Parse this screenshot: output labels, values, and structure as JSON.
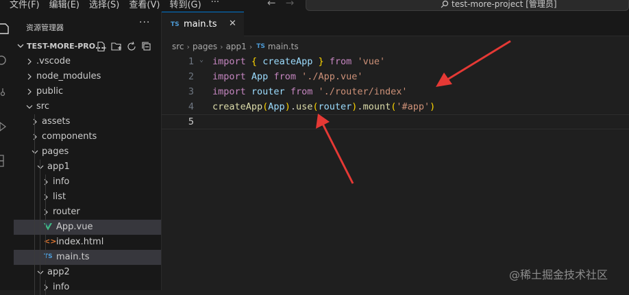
{
  "menu": [
    "文件(F)",
    "编辑(E)",
    "选择(S)",
    "查看(V)",
    "转到(G)",
    "···"
  ],
  "title_search": "test-more-project [管理员]",
  "sidebar": {
    "title": "资源管理器",
    "more": "···",
    "project": "TEST-MORE-PRO...",
    "tree": [
      {
        "label": ".vscode",
        "type": "folder",
        "level": 0,
        "expanded": false
      },
      {
        "label": "node_modules",
        "type": "folder",
        "level": 0,
        "expanded": false
      },
      {
        "label": "public",
        "type": "folder",
        "level": 0,
        "expanded": false
      },
      {
        "label": "src",
        "type": "folder",
        "level": 0,
        "expanded": true
      },
      {
        "label": "assets",
        "type": "folder",
        "level": 1,
        "expanded": false
      },
      {
        "label": "components",
        "type": "folder",
        "level": 1,
        "expanded": false
      },
      {
        "label": "pages",
        "type": "folder",
        "level": 1,
        "expanded": true
      },
      {
        "label": "app1",
        "type": "folder",
        "level": 2,
        "expanded": true
      },
      {
        "label": "info",
        "type": "folder",
        "level": 3,
        "expanded": false
      },
      {
        "label": "list",
        "type": "folder",
        "level": 3,
        "expanded": false
      },
      {
        "label": "router",
        "type": "folder",
        "level": 3,
        "expanded": false
      },
      {
        "label": "App.vue",
        "type": "vue",
        "level": 3,
        "active": true
      },
      {
        "label": "index.html",
        "type": "html",
        "level": 3
      },
      {
        "label": "main.ts",
        "type": "ts",
        "level": 3,
        "selected": true
      },
      {
        "label": "app2",
        "type": "folder",
        "level": 2,
        "expanded": true
      },
      {
        "label": "info",
        "type": "folder",
        "level": 3,
        "expanded": false
      }
    ]
  },
  "editor": {
    "tab": {
      "icon": "TS",
      "label": "main.ts",
      "close": "✕"
    },
    "breadcrumb": [
      "src",
      "pages",
      "app1"
    ],
    "breadcrumb_file": "main.ts",
    "lines": [
      {
        "n": "1",
        "tokens": [
          [
            "kw",
            "import"
          ],
          [
            "pn",
            " "
          ],
          [
            "br1",
            "{"
          ],
          [
            "pn",
            " "
          ],
          [
            "id",
            "createApp"
          ],
          [
            "pn",
            " "
          ],
          [
            "br1",
            "}"
          ],
          [
            "pn",
            " "
          ],
          [
            "kw",
            "from"
          ],
          [
            "pn",
            " "
          ],
          [
            "str",
            "'vue'"
          ]
        ]
      },
      {
        "n": "2",
        "tokens": [
          [
            "kw",
            "import"
          ],
          [
            "pn",
            " "
          ],
          [
            "id",
            "App"
          ],
          [
            "pn",
            " "
          ],
          [
            "kw",
            "from"
          ],
          [
            "pn",
            " "
          ],
          [
            "str",
            "'./App.vue'"
          ]
        ]
      },
      {
        "n": "3",
        "tokens": [
          [
            "kw",
            "import"
          ],
          [
            "pn",
            " "
          ],
          [
            "id",
            "router"
          ],
          [
            "pn",
            " "
          ],
          [
            "kw",
            "from"
          ],
          [
            "pn",
            " "
          ],
          [
            "str",
            "'./router/index'"
          ]
        ]
      },
      {
        "n": "4",
        "tokens": [
          [
            "fn",
            "createApp"
          ],
          [
            "br1",
            "("
          ],
          [
            "id",
            "App"
          ],
          [
            "br1",
            ")"
          ],
          [
            "pn",
            "."
          ],
          [
            "fn",
            "use"
          ],
          [
            "br1",
            "("
          ],
          [
            "id",
            "router"
          ],
          [
            "br1",
            ")"
          ],
          [
            "pn",
            "."
          ],
          [
            "fn",
            "mount"
          ],
          [
            "br1",
            "("
          ],
          [
            "str",
            "'#app'"
          ],
          [
            "br1",
            ")"
          ]
        ]
      },
      {
        "n": "5",
        "tokens": []
      }
    ]
  },
  "watermark": "@稀土掘金技术社区",
  "colors": {
    "accent": "#0078d4",
    "arrow": "#e53935",
    "vue": "#41b883",
    "ts": "#4d9bd6",
    "html": "#e37933"
  }
}
